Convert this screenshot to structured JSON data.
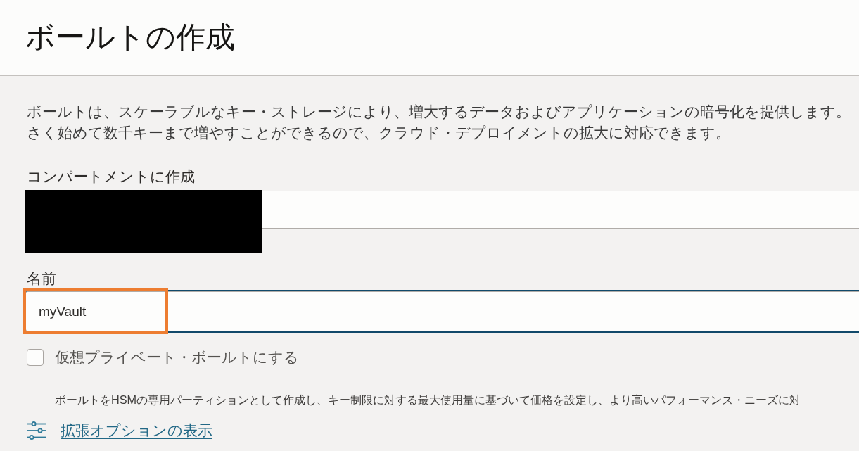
{
  "page": {
    "title": "ボールトの作成"
  },
  "description_lines": [
    "ボールトは、スケーラブルなキー・ストレージにより、増大するデータおよびアプリケーションの暗号化を提供します。",
    "さく始めて数千キーまで増やすことができるので、クラウド・デプロイメントの拡大に対応できます。"
  ],
  "fields": [
    {
      "kind": "select",
      "label": "コンパートメントに作成",
      "redacted": true,
      "focused": false,
      "highlighted": false
    },
    {
      "kind": "text",
      "label": "名前",
      "value": "myVault",
      "redacted": false,
      "focused": true,
      "highlighted": true
    }
  ],
  "checkbox": {
    "label": "仮想プライベート・ボールトにする",
    "checked": false,
    "help": "ボールトをHSMの専用パーティションとして作成し、キー制限に対する最大使用量に基づいて価格を設定し、より高いパフォーマンス・ニーズに対"
  },
  "advanced_link": {
    "label": "拡張オプションの表示"
  }
}
